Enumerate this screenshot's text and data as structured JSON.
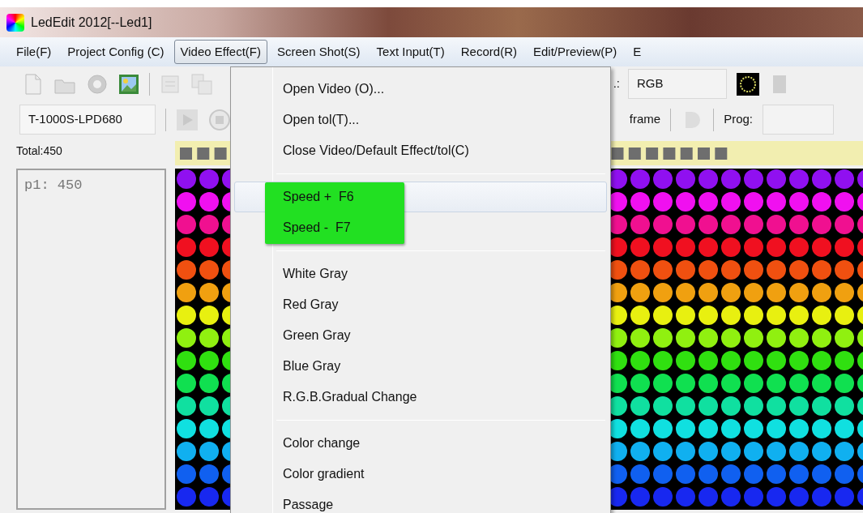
{
  "window": {
    "title": "LedEdit 2012[--Led1]"
  },
  "menu_bar": [
    {
      "label": "File(F)",
      "selected": false
    },
    {
      "label": "Project Config (C)",
      "selected": false
    },
    {
      "label": "Video Effect(F)",
      "selected": true
    },
    {
      "label": "Screen Shot(S)",
      "selected": false
    },
    {
      "label": "Text Input(T)",
      "selected": false
    },
    {
      "label": "Record(R)",
      "selected": false
    },
    {
      "label": "Edit/Preview(P)",
      "selected": false
    },
    {
      "label": "E",
      "selected": false
    }
  ],
  "toolbar": {
    "color_mode_label": ".:",
    "color_mode": "RGB",
    "controller": "T-1000S-LPD680",
    "frame_label": "frame",
    "prog_label": "Prog:"
  },
  "total": "Total:450",
  "pixel_list": "p1: 450",
  "dropdown": {
    "items": [
      {
        "kind": "item",
        "label": "Open Video (O)...",
        "selected": false,
        "annotated": false
      },
      {
        "kind": "item",
        "label": "Open tol(T)...",
        "selected": false,
        "annotated": false
      },
      {
        "kind": "item",
        "label": "Close Video/Default Effect/tol(C)",
        "selected": false,
        "annotated": false
      },
      {
        "kind": "separator"
      },
      {
        "kind": "item",
        "label": "Speed +  F6",
        "selected": true,
        "annotated": true
      },
      {
        "kind": "item",
        "label": "Speed -  F7",
        "selected": false,
        "annotated": true
      },
      {
        "kind": "separator"
      },
      {
        "kind": "item",
        "label": "White Gray",
        "selected": false,
        "annotated": false
      },
      {
        "kind": "item",
        "label": "Red Gray",
        "selected": false,
        "annotated": false
      },
      {
        "kind": "item",
        "label": "Green Gray",
        "selected": false,
        "annotated": false
      },
      {
        "kind": "item",
        "label": "Blue Gray",
        "selected": false,
        "annotated": false
      },
      {
        "kind": "item",
        "label": "R.G.B.Gradual Change",
        "selected": false,
        "annotated": false
      },
      {
        "kind": "separator"
      },
      {
        "kind": "item",
        "label": "Color change",
        "selected": false,
        "annotated": false
      },
      {
        "kind": "item",
        "label": "Color gradient",
        "selected": false,
        "annotated": false
      },
      {
        "kind": "item",
        "label": "Passage",
        "selected": false,
        "annotated": false
      }
    ]
  }
}
